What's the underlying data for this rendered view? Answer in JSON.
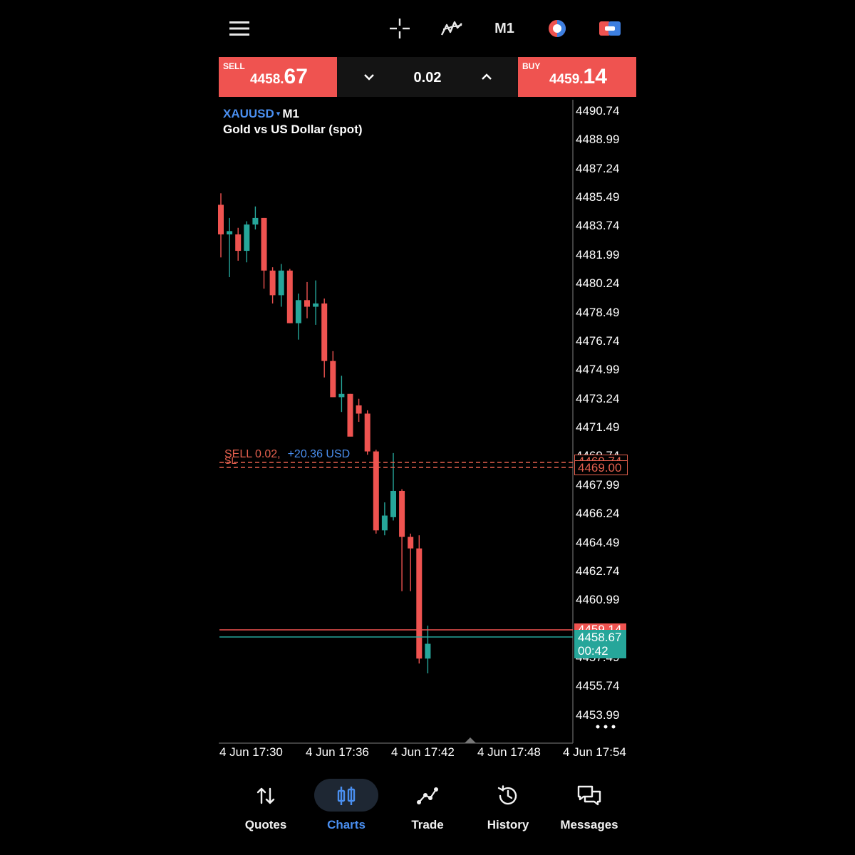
{
  "toolbar": {
    "menu_icon": "hamburger-menu-icon",
    "crosshair_icon": "crosshair-icon",
    "indicators_icon": "indicators-icon",
    "timeframe": "M1",
    "objects_icon": "chart-objects-icon",
    "trade_icon": "one-click-trade-icon"
  },
  "trade_panel": {
    "sell_label": "SELL",
    "sell_small": "4458.",
    "sell_big": "67",
    "buy_label": "BUY",
    "buy_small": "4459.",
    "buy_big": "14",
    "volume": "0.02",
    "decrease_icon": "chevron-down-icon",
    "increase_icon": "chevron-up-icon",
    "colors": {
      "sell": "#ef5350",
      "buy": "#ef5350"
    }
  },
  "chart": {
    "symbol": "XAUUSD",
    "symbol_caret": "▾",
    "timeframe": "M1",
    "description": "Gold vs US Dollar (spot)",
    "order_line": {
      "text": "SELL 0.02,",
      "profit": "+20.36 USD",
      "sl_label": "SL"
    },
    "sl_tag": "4469.00",
    "hidden_tag": "4469.74",
    "ask_tag": "4459.14",
    "bid_tag": "4458.67",
    "countdown": "00:42",
    "behind_bid_label": "4457.49",
    "behind_sl_label": "4469.74",
    "more_icon": "more-dots-icon",
    "price_axis": [
      "4490.74",
      "4488.99",
      "4487.24",
      "4485.49",
      "4483.74",
      "4481.99",
      "4480.24",
      "4478.49",
      "4476.74",
      "4474.99",
      "4473.24",
      "4471.49",
      "4467.99",
      "4466.24",
      "4464.49",
      "4462.74",
      "4460.99",
      "4455.74",
      "4453.99"
    ],
    "time_axis": [
      "4 Jun 17:30",
      "4 Jun 17:36",
      "4 Jun 17:42",
      "4 Jun 17:48",
      "4 Jun 17:54"
    ],
    "colors": {
      "bull": "#26a69a",
      "bear": "#ef5350",
      "sl": "#e5604e",
      "ask_line": "#ef5350",
      "bid_line": "#26a69a"
    }
  },
  "chart_data": {
    "type": "candlestick",
    "symbol": "XAUUSD",
    "timeframe": "M1",
    "ylim": [
      4452.5,
      4492.0
    ],
    "candles": [
      {
        "o": 4485.0,
        "h": 4485.7,
        "l": 4481.8,
        "c": 4483.2
      },
      {
        "o": 4483.2,
        "h": 4484.2,
        "l": 4480.6,
        "c": 4483.4
      },
      {
        "o": 4483.2,
        "h": 4483.6,
        "l": 4481.6,
        "c": 4482.2
      },
      {
        "o": 4482.2,
        "h": 4484.0,
        "l": 4481.5,
        "c": 4483.8
      },
      {
        "o": 4483.8,
        "h": 4484.9,
        "l": 4483.5,
        "c": 4484.2
      },
      {
        "o": 4484.2,
        "h": 4484.2,
        "l": 4479.9,
        "c": 4481.0
      },
      {
        "o": 4481.0,
        "h": 4481.2,
        "l": 4479.0,
        "c": 4479.5
      },
      {
        "o": 4479.5,
        "h": 4481.4,
        "l": 4478.8,
        "c": 4481.0
      },
      {
        "o": 4481.0,
        "h": 4481.1,
        "l": 4477.8,
        "c": 4477.8
      },
      {
        "o": 4477.8,
        "h": 4479.6,
        "l": 4476.8,
        "c": 4479.2
      },
      {
        "o": 4479.2,
        "h": 4480.3,
        "l": 4478.1,
        "c": 4478.8
      },
      {
        "o": 4478.8,
        "h": 4480.4,
        "l": 4477.7,
        "c": 4479.0
      },
      {
        "o": 4479.0,
        "h": 4479.3,
        "l": 4474.5,
        "c": 4475.5
      },
      {
        "o": 4475.5,
        "h": 4476.1,
        "l": 4473.3,
        "c": 4473.3
      },
      {
        "o": 4473.3,
        "h": 4474.6,
        "l": 4472.4,
        "c": 4473.5
      },
      {
        "o": 4473.5,
        "h": 4473.5,
        "l": 4472.8,
        "c": 4470.9
      },
      {
        "o": 4472.8,
        "h": 4473.2,
        "l": 4471.8,
        "c": 4472.3
      },
      {
        "o": 4472.3,
        "h": 4472.5,
        "l": 4469.8,
        "c": 4470.0
      },
      {
        "o": 4470.0,
        "h": 4470.1,
        "l": 4465.0,
        "c": 4465.2
      },
      {
        "o": 4465.2,
        "h": 4466.9,
        "l": 4464.9,
        "c": 4466.1
      },
      {
        "o": 4466.0,
        "h": 4469.9,
        "l": 4465.8,
        "c": 4467.6
      },
      {
        "o": 4467.6,
        "h": 4467.7,
        "l": 4461.5,
        "c": 4464.8
      },
      {
        "o": 4464.8,
        "h": 4465.0,
        "l": 4461.5,
        "c": 4464.1
      },
      {
        "o": 4464.1,
        "h": 4464.9,
        "l": 4457.1,
        "c": 4457.4
      },
      {
        "o": 4457.4,
        "h": 4459.4,
        "l": 4456.5,
        "c": 4458.3
      }
    ]
  },
  "nav": {
    "items": [
      {
        "label": "Quotes",
        "icon": "quotes-arrows-icon"
      },
      {
        "label": "Charts",
        "icon": "charts-candles-icon"
      },
      {
        "label": "Trade",
        "icon": "trade-line-icon"
      },
      {
        "label": "History",
        "icon": "history-clock-icon"
      },
      {
        "label": "Messages",
        "icon": "messages-bubbles-icon"
      }
    ],
    "active_color": "#4a8ff0"
  }
}
